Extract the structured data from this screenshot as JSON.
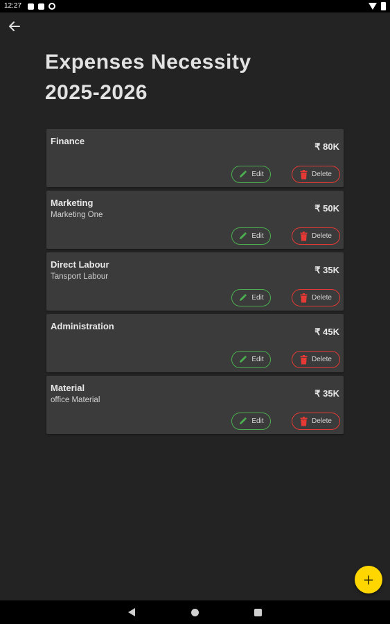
{
  "status_bar": {
    "time": "12:27",
    "icons_left": [
      "notification-square-icon",
      "sd-card-icon",
      "sync-icon"
    ],
    "icons_right": [
      "wifi-icon",
      "battery-icon"
    ]
  },
  "header": {
    "back_icon": "arrow-left-icon",
    "title_line1": "Expenses Necessity",
    "title_line2": "2025-2026"
  },
  "expenses": [
    {
      "name": "Finance",
      "description": "",
      "amount": "₹ 80K",
      "edit_label": "Edit",
      "delete_label": "Delete"
    },
    {
      "name": "Marketing",
      "description": "Marketing One",
      "amount": "₹ 50K",
      "edit_label": "Edit",
      "delete_label": "Delete"
    },
    {
      "name": "Direct Labour",
      "description": "Tansport Labour",
      "amount": "₹ 35K",
      "edit_label": "Edit",
      "delete_label": "Delete"
    },
    {
      "name": "Administration",
      "description": "",
      "amount": "₹ 45K",
      "edit_label": "Edit",
      "delete_label": "Delete"
    },
    {
      "name": "Material",
      "description": "office Material",
      "amount": "₹ 35K",
      "edit_label": "Edit",
      "delete_label": "Delete"
    }
  ],
  "fab": {
    "label": "+",
    "icon": "plus-icon"
  },
  "colors": {
    "background": "#232323",
    "card": "#3b3b3b",
    "edit_accent": "#4caf50",
    "delete_accent": "#e53935",
    "fab": "#ffd600"
  }
}
